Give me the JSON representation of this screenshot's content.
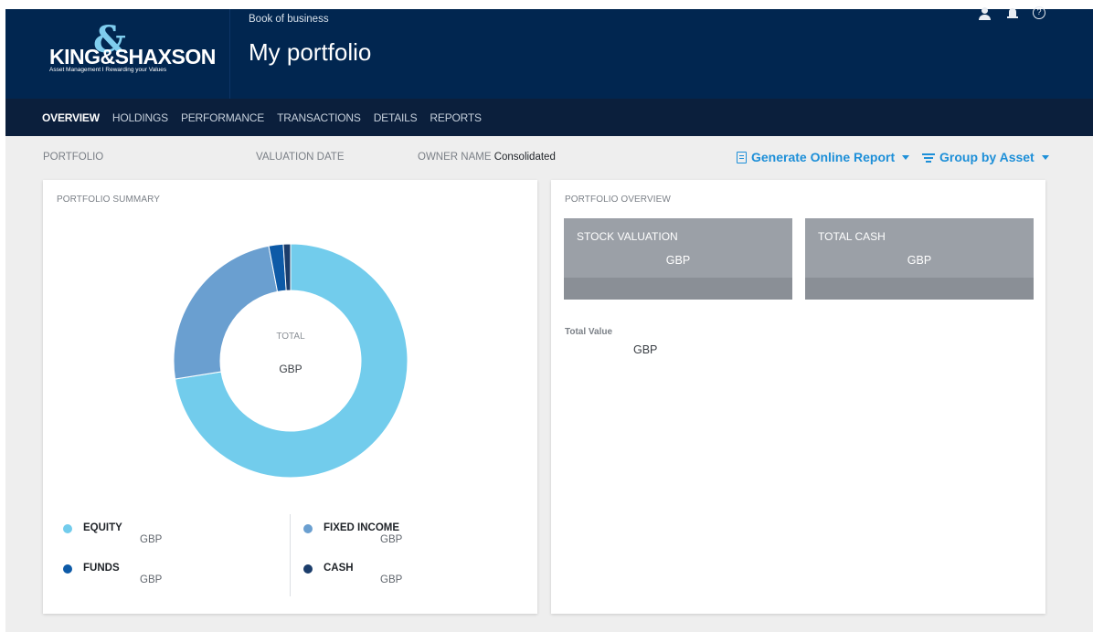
{
  "header": {
    "logo_text": "KING&SHAXSON",
    "logo_tagline": "Asset Management I Rewarding your Values",
    "breadcrumb": "Book of business",
    "title": "My portfolio",
    "help_glyph": "?"
  },
  "nav": {
    "tabs": [
      "OVERVIEW",
      "HOLDINGS",
      "PERFORMANCE",
      "TRANSACTIONS",
      "DETAILS",
      "REPORTS"
    ],
    "active": "OVERVIEW"
  },
  "filters": {
    "portfolio_label": "PORTFOLIO",
    "valuation_label": "VALUATION DATE",
    "owner_label": "OWNER NAME",
    "owner_value": "Consolidated",
    "generate_report": "Generate Online Report",
    "group_by": "Group by Asset"
  },
  "summary": {
    "title": "PORTFOLIO SUMMARY",
    "center_label": "TOTAL",
    "center_currency": "GBP",
    "legend": [
      {
        "label": "EQUITY",
        "currency": "GBP",
        "color": "#72ccec"
      },
      {
        "label": "FIXED INCOME",
        "currency": "GBP",
        "color": "#6a9fd0"
      },
      {
        "label": "FUNDS",
        "currency": "GBP",
        "color": "#0d5aa7"
      },
      {
        "label": "CASH",
        "currency": "GBP",
        "color": "#1b3d6b"
      }
    ]
  },
  "overview": {
    "title": "PORTFOLIO OVERVIEW",
    "stock_label": "STOCK VALUATION",
    "stock_currency": "GBP",
    "cash_label": "TOTAL CASH",
    "cash_currency": "GBP",
    "total_value_label": "Total Value",
    "total_value_currency": "GBP"
  },
  "chart_data": {
    "type": "pie",
    "categories": [
      "EQUITY",
      "FIXED INCOME",
      "FUNDS",
      "CASH"
    ],
    "values": [
      72.5,
      24.5,
      2.0,
      1.0
    ],
    "colors": [
      "#72ccec",
      "#6a9fd0",
      "#0d5aa7",
      "#1b3d6b"
    ],
    "donut": true
  }
}
